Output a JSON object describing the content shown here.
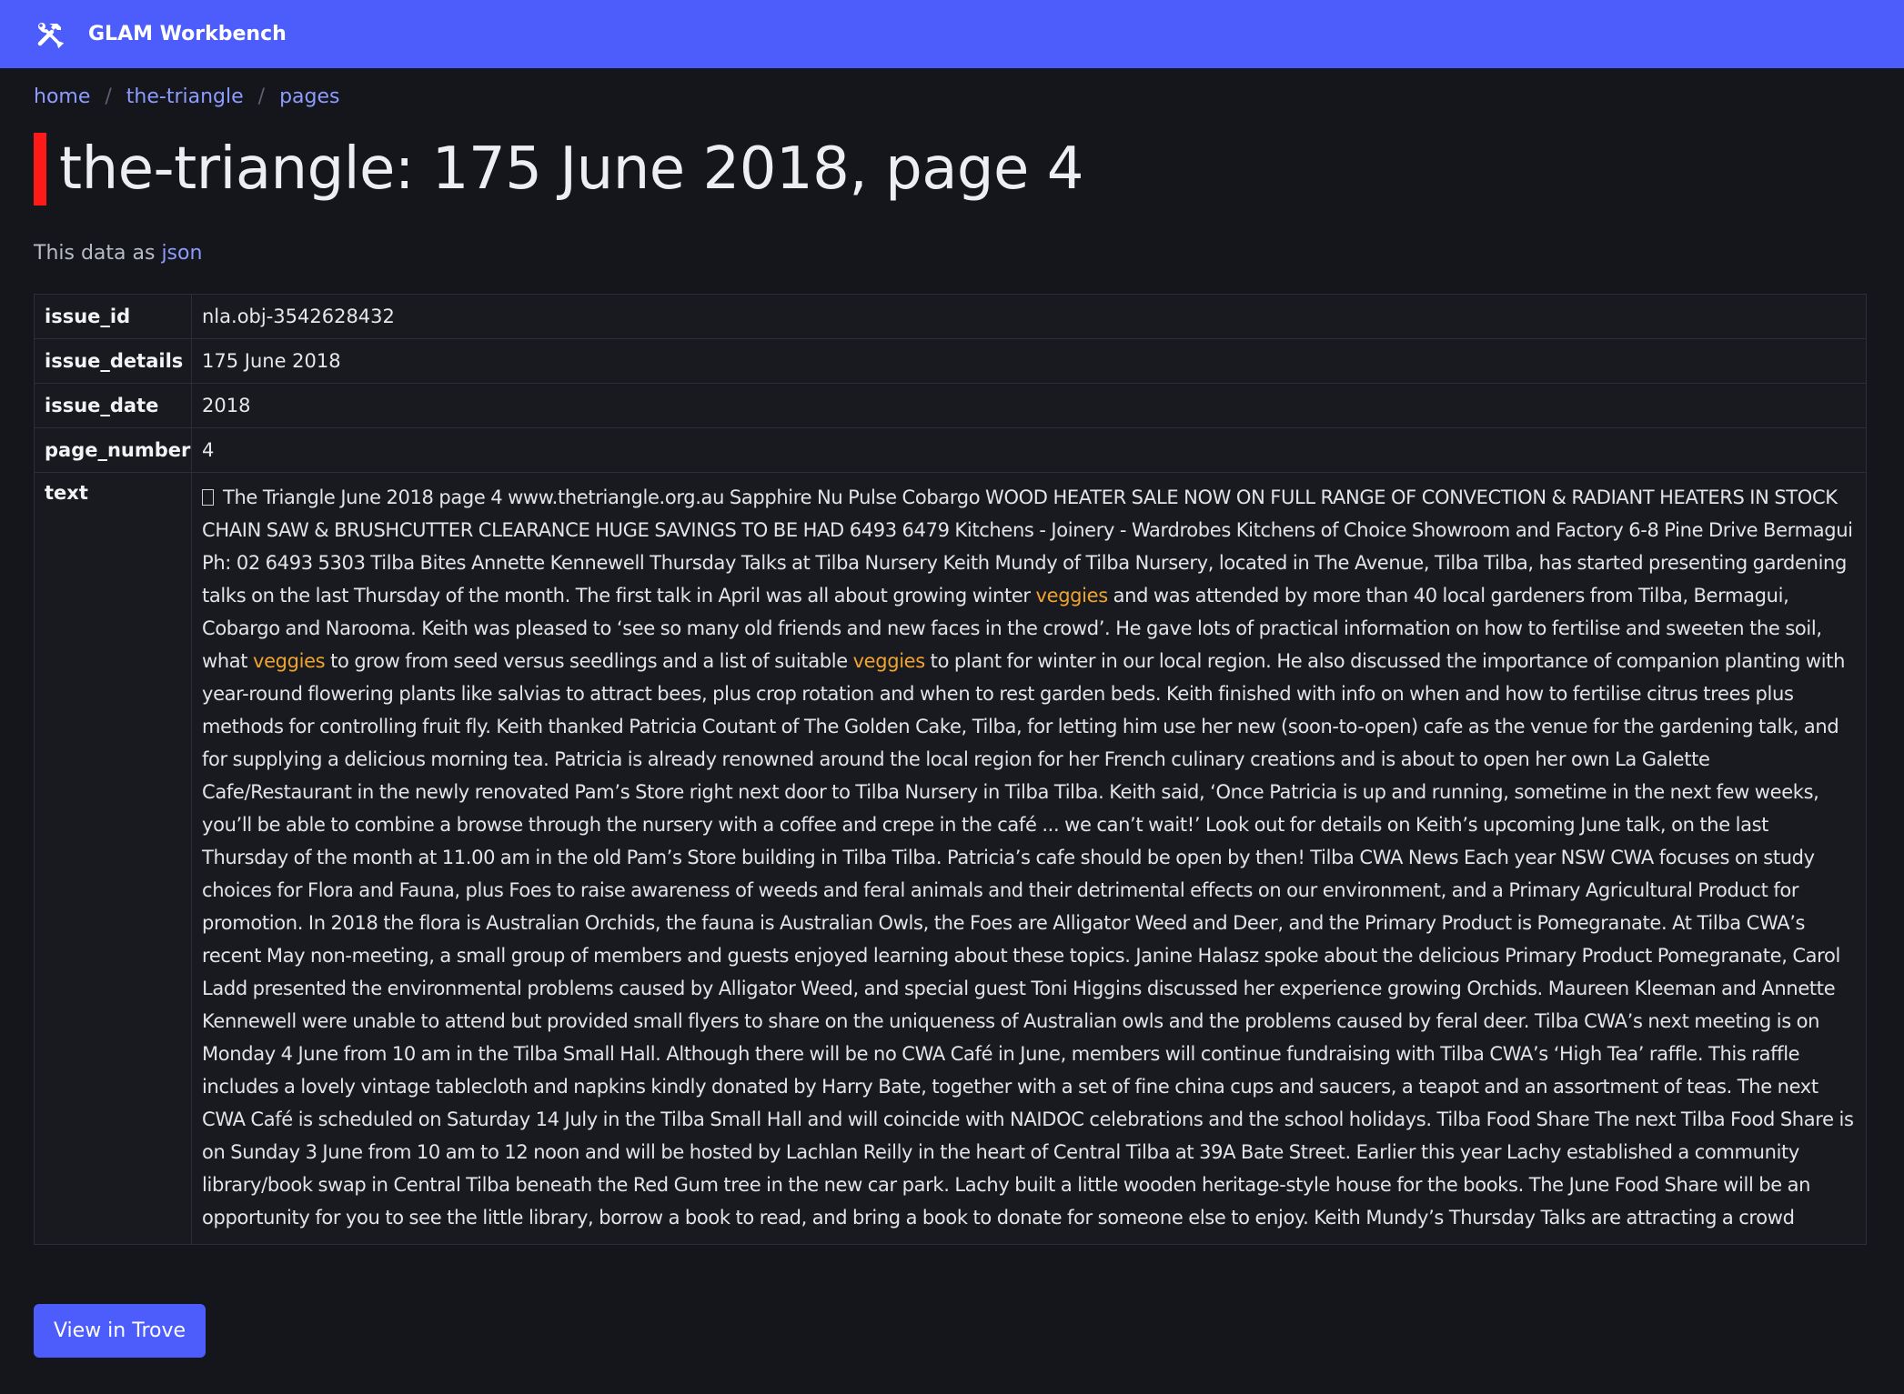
{
  "navbar": {
    "icon": "tools-icon",
    "title": "GLAM Workbench"
  },
  "breadcrumb": [
    "home",
    "the-triangle",
    "pages"
  ],
  "page_title": "the-triangle: 175 June 2018, page 4",
  "data_as": {
    "prefix": "This data as ",
    "link": "json"
  },
  "record": {
    "rows": [
      {
        "key": "issue_id",
        "value": "nla.obj-3542628432"
      },
      {
        "key": "issue_details",
        "value": "175 June 2018"
      },
      {
        "key": "issue_date",
        "value": "2018"
      },
      {
        "key": "page_number",
        "value": "4"
      }
    ],
    "text_key": "text",
    "text_segments": [
      {
        "t": "The Triangle June 2018 page 4 www.thetriangle.org.au Sapphire Nu Pulse Cobargo WOOD HEATER SALE NOW ON FULL RANGE OF CONVECTION & RADIANT HEATERS IN STOCK CHAIN SAW & BRUSHCUTTER CLEARANCE HUGE SAVINGS TO BE HAD 6493 6479 Kitchens - Joinery - Wardrobes Kitchens of Choice Showroom and Factory 6-8 Pine Drive Bermagui Ph: 02 6493 5303 Tilba Bites Annette Kennewell Thursday Talks at Tilba Nursery Keith Mundy of Tilba Nursery, located in The Avenue, Tilba Tilba, has started presenting gardening talks on the last Thursday of the month. The first talk in April was all about growing winter ",
        "hl": false
      },
      {
        "t": "veggies",
        "hl": true
      },
      {
        "t": " and was attended by more than 40 local gardeners from Tilba, Bermagui, Cobargo and Narooma. Keith was pleased to ‘see so many old friends and new faces in the crowd’. He gave lots of practical information on how to fertilise and sweeten the soil, what ",
        "hl": false
      },
      {
        "t": "veggies",
        "hl": true
      },
      {
        "t": " to grow from seed versus seedlings and a list of suitable ",
        "hl": false
      },
      {
        "t": "veggies",
        "hl": true
      },
      {
        "t": " to plant for winter in our local region. He also discussed the importance of companion planting with year-round flowering plants like salvias to attract bees, plus crop rotation and when to rest garden beds. Keith finished with info on when and how to fertilise citrus trees plus methods for controlling fruit fly. Keith thanked Patricia Coutant of The Golden Cake, Tilba, for letting him use her new (soon-to-open) cafe as the venue for the gardening talk, and for supplying a delicious morning tea. Patricia is already renowned around the local region for her French culinary creations and is about to open her own La Galette Cafe/Restaurant in the newly renovated Pam’s Store right next door to Tilba Nursery in Tilba Tilba. Keith said, ‘Once Patricia is up and running, sometime in the next few weeks, you’ll be able to combine a browse through the nursery with a coffee and crepe in the café ... we can’t wait!’ Look out for details on Keith’s upcoming June talk, on the last Thursday of the month at 11.00 am in the old Pam’s Store building in Tilba Tilba. Patricia’s cafe should be open by then! Tilba CWA News Each year NSW CWA focuses on study choices for Flora and Fauna, plus Foes to raise awareness of weeds and feral animals and their detrimental effects on our environment, and a Primary Agricultural Product for promotion. In 2018 the flora is Australian Orchids, the fauna is Australian Owls, the Foes are Alligator Weed and Deer, and the Primary Product is Pomegranate. At Tilba CWA’s recent May non-meeting, a small group of members and guests enjoyed learning about these topics. Janine Halasz spoke about the delicious Primary Product Pomegranate, Carol Ladd presented the environmental problems caused by Alligator Weed, and special guest Toni Higgins discussed her experience growing Orchids. Maureen Kleeman and Annette Kennewell were unable to attend but provided small flyers to share on the uniqueness of Australian owls and the problems caused by feral deer. Tilba CWA’s next meeting is on Monday 4 June from 10 am in the Tilba Small Hall. Although there will be no CWA Café in June, members will continue fundraising with Tilba CWA’s ‘High Tea’ raffle. This raffle includes a lovely vintage tablecloth and napkins kindly donated by Harry Bate, together with a set of fine china cups and saucers, a teapot and an assortment of teas. The next CWA Café is scheduled on Saturday 14 July in the Tilba Small Hall and will coincide with NAIDOC celebrations and the school holidays. Tilba Food Share The next Tilba Food Share is on Sunday 3 June from 10 am to 12 noon and will be hosted by Lachlan Reilly in the heart of Central Tilba at 39A Bate Street. Earlier this year Lachy established a community library/book swap in Central Tilba beneath the Red Gum tree in the new car park. Lachy built a little wooden heritage-style house for the books. The June Food Share will be an opportunity for you to see the little library, borrow a book to read, and bring a book to donate for someone else to enjoy. Keith Mundy’s Thursday Talks are attracting a crowd",
        "hl": false
      }
    ]
  },
  "actions": {
    "trove_button": "View in Trove"
  },
  "colors": {
    "navbar": "#4d5dfb",
    "background": "#14161b",
    "link": "#8d9bff",
    "highlight": "#f0a430",
    "title_accent": "#ff1a1a"
  }
}
